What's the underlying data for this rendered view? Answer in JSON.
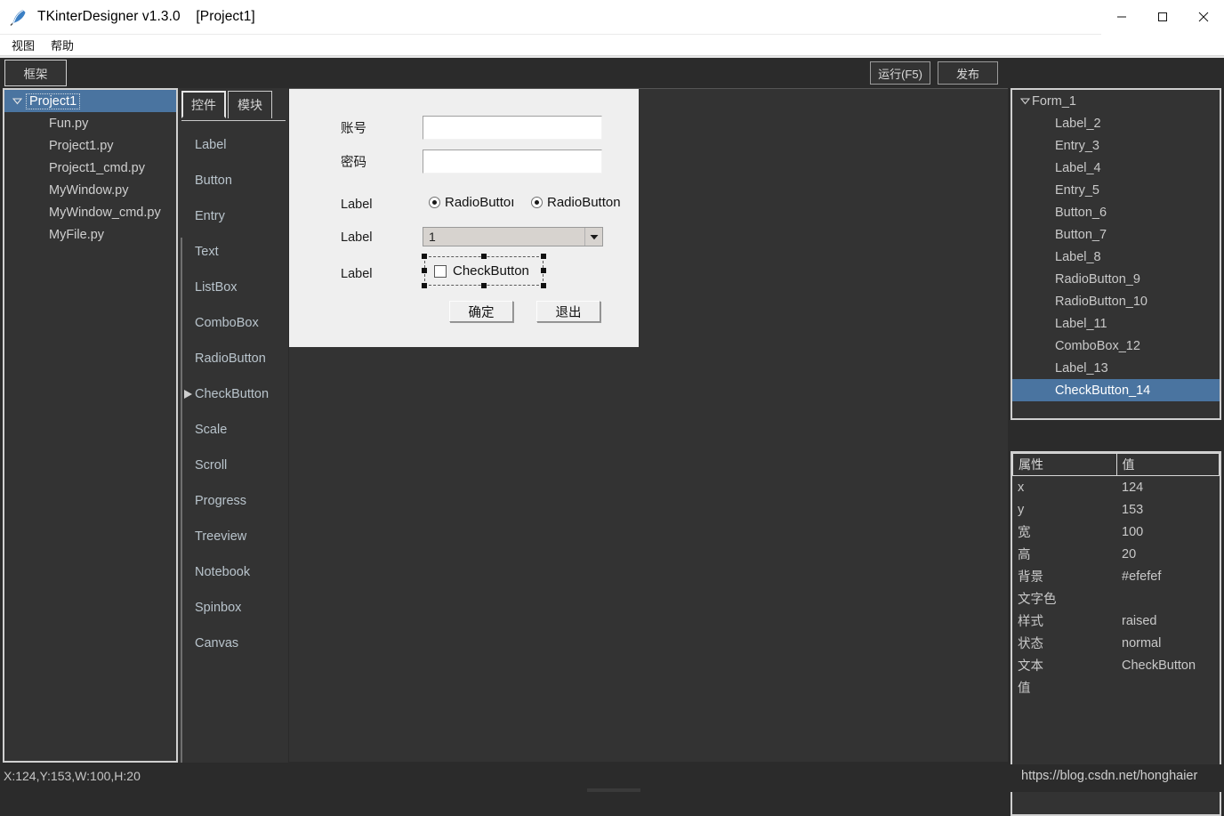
{
  "window": {
    "app_icon": "feather-pen-icon",
    "title": "TKinterDesigner v1.3.0    [Project1]",
    "minimize": "minimize-icon",
    "maximize": "maximize-icon",
    "close": "close-icon"
  },
  "menubar": {
    "items": [
      {
        "label": "视图"
      },
      {
        "label": "帮助"
      }
    ]
  },
  "toolbar": {
    "frame_tab": "框架",
    "run_label": "运行(F5)",
    "publish_label": "发布"
  },
  "project_tree": {
    "root": {
      "label": "Project1",
      "expanded": true
    },
    "children": [
      {
        "label": "Fun.py"
      },
      {
        "label": "Project1.py"
      },
      {
        "label": "Project1_cmd.py"
      },
      {
        "label": "MyWindow.py"
      },
      {
        "label": "MyWindow_cmd.py"
      },
      {
        "label": "MyFile.py"
      }
    ]
  },
  "palette": {
    "tabs": [
      {
        "label": "控件",
        "active": true
      },
      {
        "label": "模块",
        "active": false
      }
    ],
    "selected": "CheckButton",
    "items": [
      {
        "label": "Label"
      },
      {
        "label": "Button"
      },
      {
        "label": "Entry"
      },
      {
        "label": "Text"
      },
      {
        "label": "ListBox"
      },
      {
        "label": "ComboBox"
      },
      {
        "label": "RadioButton"
      },
      {
        "label": "CheckButton"
      },
      {
        "label": "Scale"
      },
      {
        "label": "Scroll"
      },
      {
        "label": "Progress"
      },
      {
        "label": "Treeview"
      },
      {
        "label": "Notebook"
      },
      {
        "label": "Spinbox"
      },
      {
        "label": "Canvas"
      }
    ]
  },
  "designer": {
    "form_background": "#efefef",
    "labels": {
      "account": "账号",
      "password": "密码",
      "label_radio": "Label",
      "label_combo": "Label",
      "label_check": "Label"
    },
    "entries": {
      "account_value": "",
      "password_value": ""
    },
    "radios": [
      {
        "label": "RadioButtoı",
        "checked": true
      },
      {
        "label": "RadioButton",
        "checked": true
      }
    ],
    "combo": {
      "value": "1",
      "arrow": "chevron-down-icon"
    },
    "check": {
      "label": "CheckButton",
      "checked": false,
      "selected": true
    },
    "buttons": [
      {
        "label": "确定"
      },
      {
        "label": "退出"
      }
    ]
  },
  "object_tree": {
    "root": {
      "label": "Form_1",
      "expanded": true
    },
    "children": [
      {
        "label": "Label_2",
        "selected": false
      },
      {
        "label": "Entry_3",
        "selected": false
      },
      {
        "label": "Label_4",
        "selected": false
      },
      {
        "label": "Entry_5",
        "selected": false
      },
      {
        "label": "Button_6",
        "selected": false
      },
      {
        "label": "Button_7",
        "selected": false
      },
      {
        "label": "Label_8",
        "selected": false
      },
      {
        "label": "RadioButton_9",
        "selected": false
      },
      {
        "label": "RadioButton_10",
        "selected": false
      },
      {
        "label": "Label_11",
        "selected": false
      },
      {
        "label": "ComboBox_12",
        "selected": false
      },
      {
        "label": "Label_13",
        "selected": false
      },
      {
        "label": "CheckButton_14",
        "selected": true
      }
    ]
  },
  "properties": {
    "header": {
      "key": "属性",
      "value": "值"
    },
    "rows": [
      {
        "key": "x",
        "value": "124"
      },
      {
        "key": "y",
        "value": "153"
      },
      {
        "key": "宽",
        "value": "100"
      },
      {
        "key": "高",
        "value": "20"
      },
      {
        "key": "背景",
        "value": "#efefef"
      },
      {
        "key": "文字色",
        "value": ""
      },
      {
        "key": "样式",
        "value": "raised"
      },
      {
        "key": "状态",
        "value": "normal"
      },
      {
        "key": "文本",
        "value": "CheckButton"
      },
      {
        "key": "值",
        "value": ""
      }
    ]
  },
  "statusbar": {
    "coords": "X:124,Y:153,W:100,H:20",
    "watermark": "https://blog.csdn.net/honghaier"
  },
  "colors": {
    "selection_blue": "#4a74a0",
    "panel_dark": "#333333",
    "app_dark": "#2b2b2b",
    "form_bg": "#efefef"
  }
}
